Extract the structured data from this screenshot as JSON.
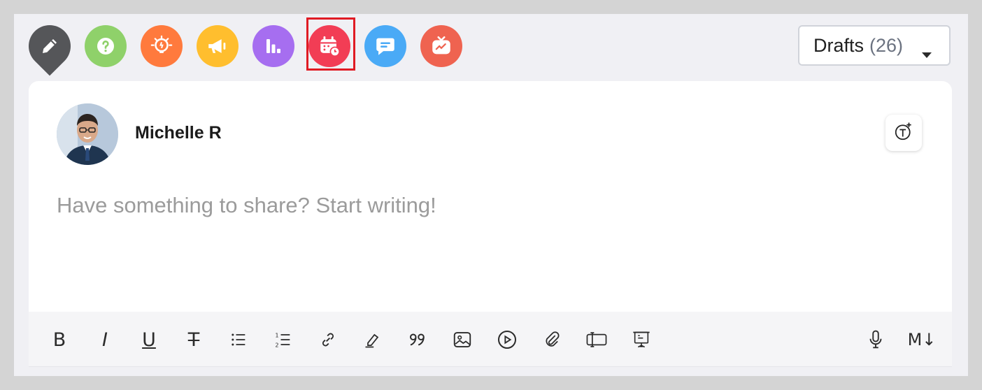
{
  "categories": [
    {
      "name": "write",
      "icon": "pencil-icon",
      "color": "#555659"
    },
    {
      "name": "question",
      "icon": "question-icon",
      "color": "#8fd16a"
    },
    {
      "name": "idea",
      "icon": "lightbulb-icon",
      "color": "#ff7a3d"
    },
    {
      "name": "announcement",
      "icon": "megaphone-icon",
      "color": "#ffbe2e"
    },
    {
      "name": "poll",
      "icon": "bar-chart-icon",
      "color": "#a66ef0"
    },
    {
      "name": "event",
      "icon": "calendar-clock-icon",
      "color": "#f23d55",
      "selected": true
    },
    {
      "name": "discussion",
      "icon": "chat-bubble-icon",
      "color": "#4aaaf6"
    },
    {
      "name": "video",
      "icon": "tv-icon",
      "color": "#ef6350"
    }
  ],
  "drafts": {
    "label": "Drafts",
    "count": "(26)"
  },
  "user": {
    "name": "Michelle R"
  },
  "composer": {
    "placeholder": "Have something to share? Start writing!"
  },
  "toolbar": {
    "bold": "B",
    "italic": "I",
    "underline": "U",
    "strike": "T",
    "markdown": "M↓",
    "items": [
      "bold-icon",
      "italic-icon",
      "underline-icon",
      "strikethrough-icon",
      "bullet-list-icon",
      "numbered-list-icon",
      "link-icon",
      "highlighter-icon",
      "quote-icon",
      "image-icon",
      "video-icon",
      "attachment-icon",
      "embed-icon",
      "presentation-icon",
      "microphone-icon",
      "markdown-icon"
    ]
  }
}
